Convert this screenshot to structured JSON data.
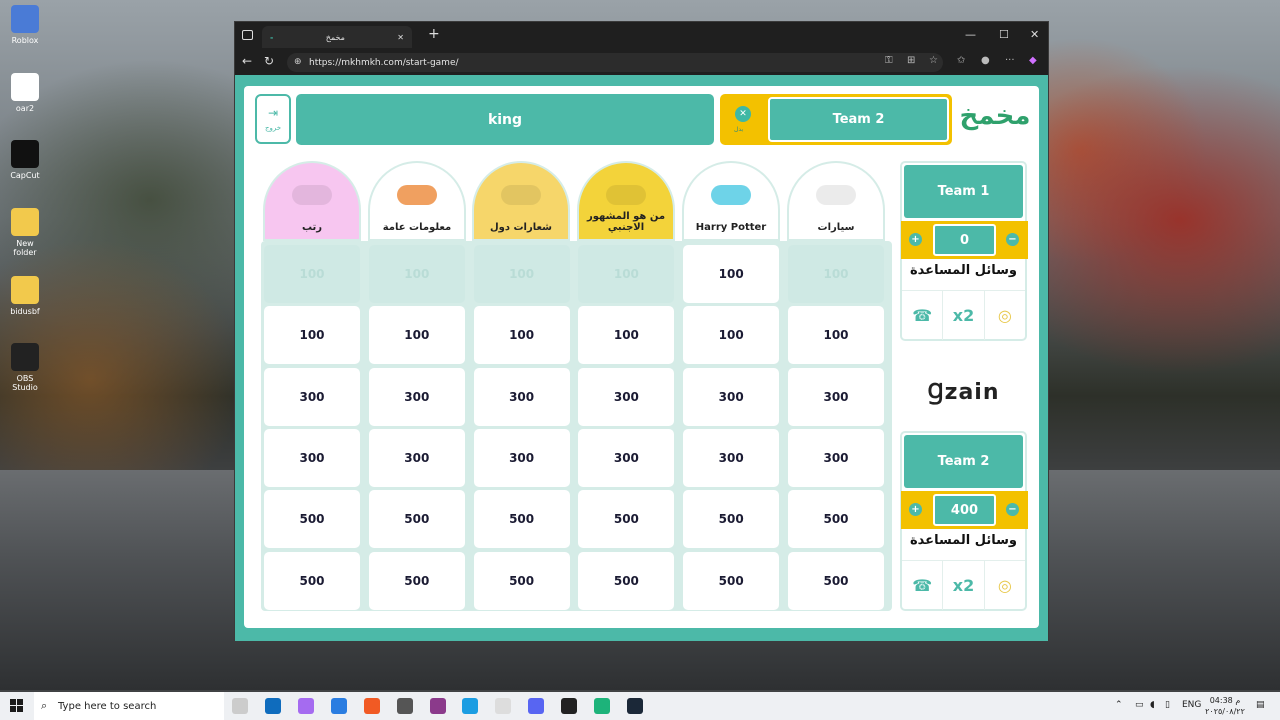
{
  "desktop": {
    "icons": [
      {
        "label": "Roblox",
        "icon": "roblox-icon",
        "color": "#4a7bd6"
      },
      {
        "label": "oar2",
        "icon": "file-icon",
        "color": "#ffffff"
      },
      {
        "label": "CapCut",
        "icon": "capcut-icon",
        "color": "#111111"
      },
      {
        "label": "New folder",
        "icon": "folder-icon",
        "color": "#f2c94c"
      },
      {
        "label": "bidusbf",
        "icon": "folder-icon",
        "color": "#f2c94c"
      },
      {
        "label": "OBS Studio",
        "icon": "obs-icon",
        "color": "#222222"
      }
    ]
  },
  "browser": {
    "tab_title": "مخمخ",
    "tab_dash": "-",
    "url": "https://mkhmkh.com/start-game/",
    "new_tab": "+"
  },
  "game": {
    "exit_label": "خروج",
    "exit_glyph": "⇥",
    "current_player": "king",
    "turn_team": "Team 2",
    "turn_sub": "بدل",
    "logo_text": "مخمخ",
    "categories": [
      {
        "label": "رتب",
        "color": "#f7c6f0"
      },
      {
        "label": "معلومات عامة",
        "color": "#ffffff"
      },
      {
        "label": "شعارات دول",
        "color": "#f6d66a"
      },
      {
        "label": "من هو المشهور الاجنبي",
        "color": "#f3d33a"
      },
      {
        "label": "Harry Potter",
        "color": "#ffffff"
      },
      {
        "label": "سيارات",
        "color": "#ffffff"
      }
    ],
    "grid": [
      [
        "100",
        "100",
        "100",
        "100",
        "100",
        "100"
      ],
      [
        "100",
        "100",
        "100",
        "100",
        "100",
        "100"
      ],
      [
        "300",
        "300",
        "300",
        "300",
        "300",
        "300"
      ],
      [
        "300",
        "300",
        "300",
        "300",
        "300",
        "300"
      ],
      [
        "500",
        "500",
        "500",
        "500",
        "500",
        "500"
      ],
      [
        "500",
        "500",
        "500",
        "500",
        "500",
        "500"
      ]
    ],
    "used_cells": [
      [
        0,
        0
      ],
      [
        0,
        1
      ],
      [
        0,
        2
      ],
      [
        0,
        3
      ],
      [
        0,
        5
      ]
    ],
    "teams": [
      {
        "name": "Team 1",
        "score": "0",
        "aids_title": "وسائل المساعدة"
      },
      {
        "name": "Team 2",
        "score": "400",
        "aids_title": "وسائل المساعدة"
      }
    ],
    "plus": "+",
    "minus": "−",
    "sponsor": "Ɡzain"
  },
  "taskbar": {
    "search_placeholder": "Type here to search",
    "lang": "ENG",
    "time": "04:38 م",
    "date": "٢٠٢٥/٠٨/٢٢"
  },
  "colors": {
    "teal": "#4cb9a8",
    "yellow": "#f3c100",
    "used_cell": "#cfe9e4"
  }
}
